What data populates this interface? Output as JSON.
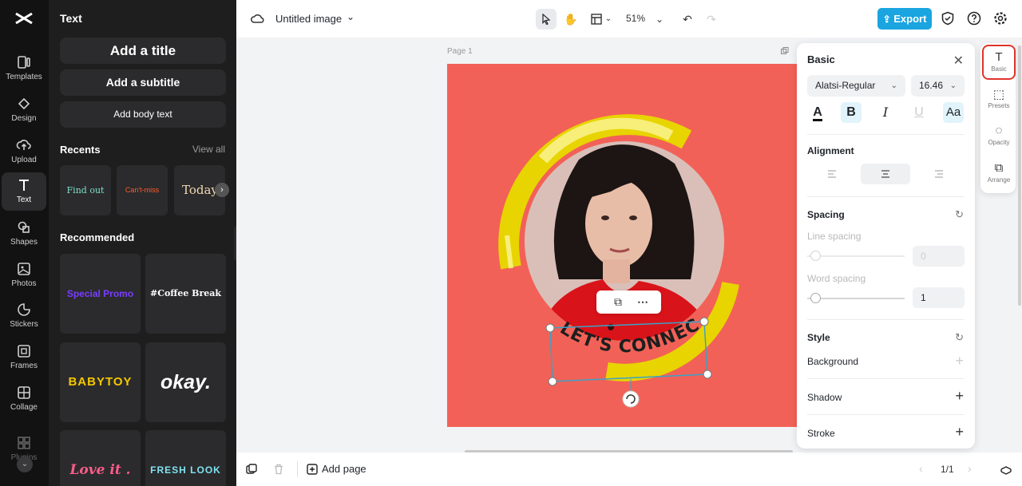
{
  "rail": {
    "items": [
      {
        "label": "Templates",
        "icon": "templates-icon"
      },
      {
        "label": "Design",
        "icon": "design-icon"
      },
      {
        "label": "Upload",
        "icon": "upload-icon"
      },
      {
        "label": "Text",
        "icon": "text-icon"
      },
      {
        "label": "Shapes",
        "icon": "shapes-icon"
      },
      {
        "label": "Photos",
        "icon": "photos-icon"
      },
      {
        "label": "Stickers",
        "icon": "stickers-icon"
      },
      {
        "label": "Frames",
        "icon": "frames-icon"
      },
      {
        "label": "Collage",
        "icon": "collage-icon"
      },
      {
        "label": "Plugins",
        "icon": "plugins-icon"
      }
    ]
  },
  "panel": {
    "title": "Text",
    "add_title": "Add a title",
    "add_subtitle": "Add a subtitle",
    "add_body": "Add body text",
    "recents_title": "Recents",
    "view_all": "View all",
    "recents": [
      "Find out",
      "Can't-miss",
      "Today"
    ],
    "recommended_title": "Recommended",
    "recommended": [
      "Special Promo",
      "#Coffee Break",
      "BABYTOY",
      "okay.",
      "Love it .",
      "FRESH LOOK"
    ]
  },
  "topbar": {
    "doc_title": "Untitled image",
    "zoom": "51%",
    "export": "Export"
  },
  "canvas": {
    "page_label": "Page 1",
    "text_line1": "LET'S",
    "text_line2": "CONNECT"
  },
  "bottombar": {
    "add_page": "Add page",
    "pager": "1/1"
  },
  "props": {
    "title": "Basic",
    "font": "Alatsi-Regular",
    "font_size": "16.46",
    "alignment_title": "Alignment",
    "spacing_title": "Spacing",
    "line_spacing_label": "Line spacing",
    "line_spacing_value": "0",
    "word_spacing_label": "Word spacing",
    "word_spacing_value": "1",
    "style_title": "Style",
    "background_label": "Background",
    "shadow_label": "Shadow",
    "stroke_label": "Stroke"
  },
  "tabs": [
    {
      "label": "Basic",
      "icon": "T"
    },
    {
      "label": "Presets",
      "icon": "⬚"
    },
    {
      "label": "Opacity",
      "icon": "◌"
    },
    {
      "label": "Arrange",
      "icon": "⧉"
    }
  ],
  "colors": {
    "artboard": "#f26157",
    "ring": "#e8d400",
    "export": "#1aa5e0",
    "active_tab_border": "#e0342c"
  }
}
